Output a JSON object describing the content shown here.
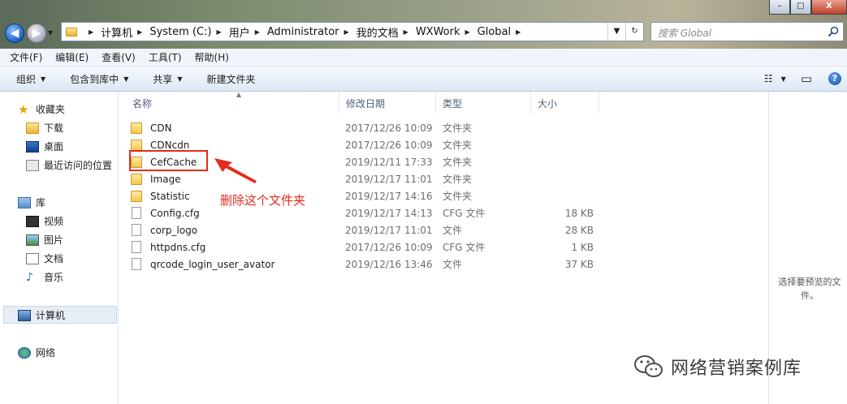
{
  "window": {
    "minimize": "–",
    "maximize": "□",
    "close": "X"
  },
  "nav": {
    "back": "◀",
    "forward": "▶",
    "dropdown": "▼"
  },
  "address": {
    "crumbs": [
      "计算机",
      "System (C:)",
      "用户",
      "Administrator",
      "我的文档",
      "WXWork",
      "Global"
    ],
    "separator": "▶",
    "refresh": "↻",
    "go": "▼"
  },
  "search": {
    "placeholder": "搜索 Global"
  },
  "menu": [
    "文件(F)",
    "编辑(E)",
    "查看(V)",
    "工具(T)",
    "帮助(H)"
  ],
  "commands": {
    "organize": "组织",
    "include": "包含到库中",
    "share": "共享",
    "new_folder": "新建文件夹",
    "caret": "▼",
    "view_icon": "☷",
    "view_caret": "▼",
    "preview_icon": "▭",
    "help": "?"
  },
  "sidebar": {
    "favorites": "收藏夹",
    "downloads": "下载",
    "desktop": "桌面",
    "recent": "最近访问的位置",
    "libraries": "库",
    "videos": "视频",
    "pictures": "图片",
    "documents": "文档",
    "music": "音乐",
    "computer": "计算机",
    "network": "网络"
  },
  "columns": {
    "name": "名称",
    "date": "修改日期",
    "type": "类型",
    "size": "大小"
  },
  "files": [
    {
      "name": "CDN",
      "date": "2017/12/26 10:09",
      "type": "文件夹",
      "size": "",
      "kind": "folder"
    },
    {
      "name": "CDNcdn",
      "date": "2017/12/26 10:09",
      "type": "文件夹",
      "size": "",
      "kind": "folder"
    },
    {
      "name": "CefCache",
      "date": "2019/12/11 17:33",
      "type": "文件夹",
      "size": "",
      "kind": "folder"
    },
    {
      "name": "Image",
      "date": "2019/12/17 11:01",
      "type": "文件夹",
      "size": "",
      "kind": "folder"
    },
    {
      "name": "Statistic",
      "date": "2019/12/17 14:16",
      "type": "文件夹",
      "size": "",
      "kind": "folder"
    },
    {
      "name": "Config.cfg",
      "date": "2019/12/17 14:13",
      "type": "CFG 文件",
      "size": "18 KB",
      "kind": "file"
    },
    {
      "name": "corp_logo",
      "date": "2019/12/17 11:01",
      "type": "文件",
      "size": "28 KB",
      "kind": "file"
    },
    {
      "name": "httpdns.cfg",
      "date": "2017/12/26 10:09",
      "type": "CFG 文件",
      "size": "1 KB",
      "kind": "file"
    },
    {
      "name": "qrcode_login_user_avator",
      "date": "2019/12/16 13:46",
      "type": "文件",
      "size": "37 KB",
      "kind": "file"
    }
  ],
  "annotation": "删除这个文件夹",
  "preview": "选择要预览的文件。",
  "watermark": "网络营销案例库",
  "colors": {
    "annotation": "#e52b1a",
    "folder": "#f4c84d"
  }
}
